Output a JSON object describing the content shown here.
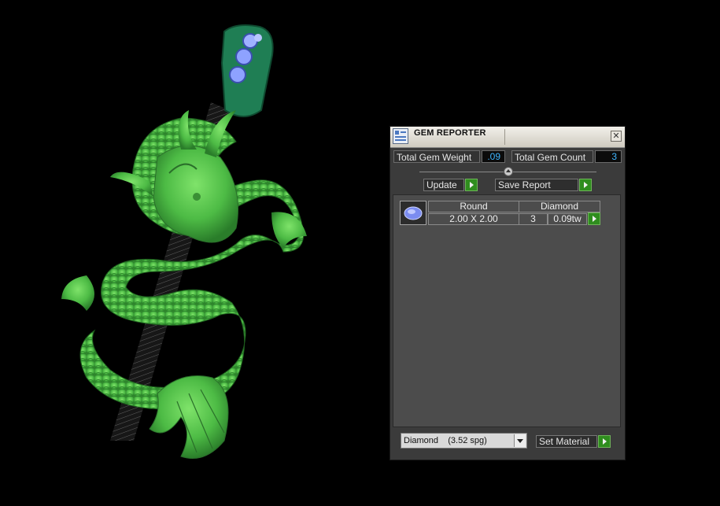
{
  "panel": {
    "title": "GEM REPORTER",
    "close_glyph": "✕",
    "total_weight_label": "Total Gem Weight",
    "total_weight_value": ".09",
    "total_count_label": "Total Gem Count",
    "total_count_value": "3",
    "update_label": "Update",
    "save_report_label": "Save Report",
    "gems": [
      {
        "shape": "Round",
        "size": "2.00 X 2.00",
        "material": "Diamond",
        "count": "3",
        "weight": "0.09tw",
        "icon": "round-gem-icon"
      }
    ],
    "material_select": {
      "material": "Diamond",
      "spg": "(3.52 spg)"
    },
    "set_material_label": "Set Material",
    "colors": {
      "accent_green": "#2f8d1e",
      "value_blue": "#3fb6ff"
    }
  },
  "viewport": {
    "model": "dragon-pendant-icon",
    "model_color": "#52c24a",
    "bail_color": "#1e7a52"
  }
}
